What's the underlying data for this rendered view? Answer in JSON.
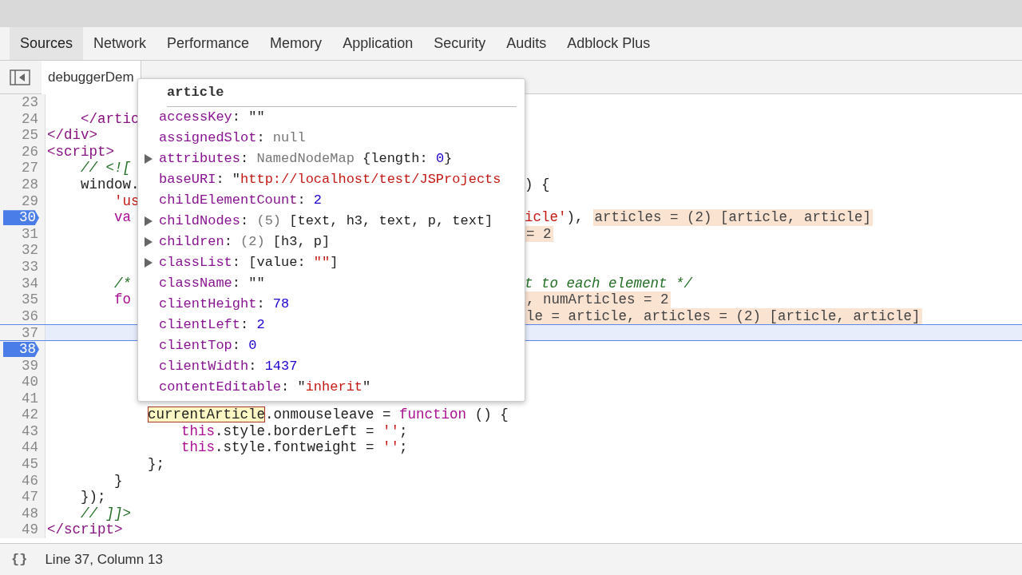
{
  "panel_tabs": [
    {
      "label": "Sources",
      "selected": true
    },
    {
      "label": "Network",
      "selected": false
    },
    {
      "label": "Performance",
      "selected": false
    },
    {
      "label": "Memory",
      "selected": false
    },
    {
      "label": "Application",
      "selected": false
    },
    {
      "label": "Security",
      "selected": false
    },
    {
      "label": "Audits",
      "selected": false
    },
    {
      "label": "Adblock Plus",
      "selected": false
    }
  ],
  "file_tabs": [
    {
      "label": "debuggerDem",
      "selected": true
    }
  ],
  "code_lines": [
    {
      "number": "23",
      "breakpoint": false,
      "current": false
    },
    {
      "number": "24",
      "breakpoint": false,
      "current": false,
      "left": [
        {
          "text": "    </artic",
          "kind": "tag"
        }
      ]
    },
    {
      "number": "25",
      "breakpoint": false,
      "current": false,
      "left": [
        {
          "text": "</div>",
          "kind": "tag"
        }
      ]
    },
    {
      "number": "26",
      "breakpoint": false,
      "current": false,
      "left": [
        {
          "text": "<script>",
          "kind": "tag"
        }
      ]
    },
    {
      "number": "27",
      "breakpoint": false,
      "current": false,
      "left": [
        {
          "text": "    // <![",
          "kind": "comment"
        }
      ]
    },
    {
      "number": "28",
      "breakpoint": false,
      "current": false,
      "left": [
        {
          "text": "    window.",
          "kind": "plain"
        }
      ],
      "right": [
        {
          "text": ") {",
          "kind": "plain"
        }
      ]
    },
    {
      "number": "29",
      "breakpoint": false,
      "current": false,
      "left": [
        {
          "text": "        'us",
          "kind": "string"
        }
      ]
    },
    {
      "number": "30",
      "breakpoint": true,
      "current": false,
      "left": [
        {
          "text": "        va",
          "kind": "keyword"
        }
      ],
      "right": [
        {
          "text": "icle'",
          "kind": "string"
        },
        {
          "text": "),",
          "kind": "plain"
        },
        {
          "text": "articles = (2) [article, article]",
          "kind": "value"
        }
      ]
    },
    {
      "number": "31",
      "breakpoint": false,
      "current": false,
      "right": [
        {
          "text": "= 2",
          "kind": "value"
        }
      ]
    },
    {
      "number": "32",
      "breakpoint": false,
      "current": false
    },
    {
      "number": "33",
      "breakpoint": false,
      "current": false
    },
    {
      "number": "34",
      "breakpoint": false,
      "current": false,
      "left": [
        {
          "text": "        /*",
          "kind": "comment"
        }
      ],
      "right": [
        {
          "text": "t to each element */",
          "kind": "comment"
        }
      ]
    },
    {
      "number": "35",
      "breakpoint": false,
      "current": false,
      "left": [
        {
          "text": "        fo",
          "kind": "keyword"
        }
      ],
      "right": [
        {
          "text": ", numArticles = 2",
          "kind": "value"
        }
      ]
    },
    {
      "number": "36",
      "breakpoint": false,
      "current": false,
      "right": [
        {
          "text": "le = article, articles = (2) [article, article]",
          "kind": "value"
        }
      ]
    },
    {
      "number": "37",
      "breakpoint": false,
      "current": true
    },
    {
      "number": "38",
      "breakpoint": true,
      "current": false
    },
    {
      "number": "39",
      "breakpoint": false,
      "current": false
    },
    {
      "number": "40",
      "breakpoint": false,
      "current": false
    },
    {
      "number": "41",
      "breakpoint": false,
      "current": false
    },
    {
      "number": "42",
      "breakpoint": false,
      "current": false,
      "left": [
        {
          "text": "            currentArticle",
          "kind": "hovered"
        },
        {
          "text": ".onmouseleave = ",
          "kind": "plain"
        },
        {
          "text": "function",
          "kind": "keyword"
        },
        {
          "text": " () {",
          "kind": "plain"
        }
      ]
    },
    {
      "number": "43",
      "breakpoint": false,
      "current": false,
      "left": [
        {
          "text": "                this",
          "kind": "keyword"
        },
        {
          "text": ".style.borderLeft = ",
          "kind": "plain"
        },
        {
          "text": "''",
          "kind": "string"
        },
        {
          "text": ";",
          "kind": "plain"
        }
      ]
    },
    {
      "number": "44",
      "breakpoint": false,
      "current": false,
      "left": [
        {
          "text": "                this",
          "kind": "keyword"
        },
        {
          "text": ".style.fontweight = ",
          "kind": "plain"
        },
        {
          "text": "''",
          "kind": "string"
        },
        {
          "text": ";",
          "kind": "plain"
        }
      ]
    },
    {
      "number": "45",
      "breakpoint": false,
      "current": false,
      "left": [
        {
          "text": "            };",
          "kind": "plain"
        }
      ]
    },
    {
      "number": "46",
      "breakpoint": false,
      "current": false,
      "left": [
        {
          "text": "        }",
          "kind": "plain"
        }
      ]
    },
    {
      "number": "47",
      "breakpoint": false,
      "current": false,
      "left": [
        {
          "text": "    });",
          "kind": "plain"
        }
      ]
    },
    {
      "number": "48",
      "breakpoint": false,
      "current": false,
      "left": [
        {
          "text": "    // ]]>",
          "kind": "comment"
        }
      ]
    },
    {
      "number": "49",
      "breakpoint": false,
      "current": false,
      "left": [
        {
          "text": "</script>",
          "kind": "tag"
        }
      ]
    }
  ],
  "popover": {
    "title": "article",
    "properties": [
      {
        "name": "accessKey",
        "expandable": false,
        "value": [
          {
            "text": ": \"\"",
            "kind": "plain"
          }
        ]
      },
      {
        "name": "assignedSlot",
        "expandable": false,
        "value": [
          {
            "text": ": ",
            "kind": "plain"
          },
          {
            "text": "null",
            "kind": "gray"
          }
        ]
      },
      {
        "name": "attributes",
        "expandable": true,
        "value": [
          {
            "text": ": ",
            "kind": "plain"
          },
          {
            "text": "NamedNodeMap",
            "kind": "gray"
          },
          {
            "text": " {length: ",
            "kind": "plain"
          },
          {
            "text": "0",
            "kind": "number"
          },
          {
            "text": "}",
            "kind": "plain"
          }
        ]
      },
      {
        "name": "baseURI",
        "expandable": false,
        "value": [
          {
            "text": ": \"",
            "kind": "plain"
          },
          {
            "text": "http://localhost/test/JSProjects",
            "kind": "string"
          }
        ]
      },
      {
        "name": "childElementCount",
        "expandable": false,
        "value": [
          {
            "text": ": ",
            "kind": "plain"
          },
          {
            "text": "2",
            "kind": "number"
          }
        ]
      },
      {
        "name": "childNodes",
        "expandable": true,
        "value": [
          {
            "text": ": ",
            "kind": "plain"
          },
          {
            "text": "(5)",
            "kind": "gray"
          },
          {
            "text": " [text, h3, text, p, text]",
            "kind": "plain"
          }
        ]
      },
      {
        "name": "children",
        "expandable": true,
        "value": [
          {
            "text": ": ",
            "kind": "plain"
          },
          {
            "text": "(2)",
            "kind": "gray"
          },
          {
            "text": " [h3, p]",
            "kind": "plain"
          }
        ]
      },
      {
        "name": "classList",
        "expandable": true,
        "value": [
          {
            "text": ": [value: ",
            "kind": "plain"
          },
          {
            "text": "\"\"",
            "kind": "string"
          },
          {
            "text": "]",
            "kind": "plain"
          }
        ]
      },
      {
        "name": "className",
        "expandable": false,
        "value": [
          {
            "text": ": \"\"",
            "kind": "plain"
          }
        ]
      },
      {
        "name": "clientHeight",
        "expandable": false,
        "value": [
          {
            "text": ": ",
            "kind": "plain"
          },
          {
            "text": "78",
            "kind": "number"
          }
        ]
      },
      {
        "name": "clientLeft",
        "expandable": false,
        "value": [
          {
            "text": ": ",
            "kind": "plain"
          },
          {
            "text": "2",
            "kind": "number"
          }
        ]
      },
      {
        "name": "clientTop",
        "expandable": false,
        "value": [
          {
            "text": ": ",
            "kind": "plain"
          },
          {
            "text": "0",
            "kind": "number"
          }
        ]
      },
      {
        "name": "clientWidth",
        "expandable": false,
        "value": [
          {
            "text": ": ",
            "kind": "plain"
          },
          {
            "text": "1437",
            "kind": "number"
          }
        ]
      },
      {
        "name": "contentEditable",
        "expandable": false,
        "value": [
          {
            "text": ": \"",
            "kind": "plain"
          },
          {
            "text": "inherit",
            "kind": "string"
          },
          {
            "text": "\"",
            "kind": "plain"
          }
        ]
      }
    ]
  },
  "status_bar": {
    "format_icon": "{}",
    "position": "Line 37, Column 13"
  }
}
